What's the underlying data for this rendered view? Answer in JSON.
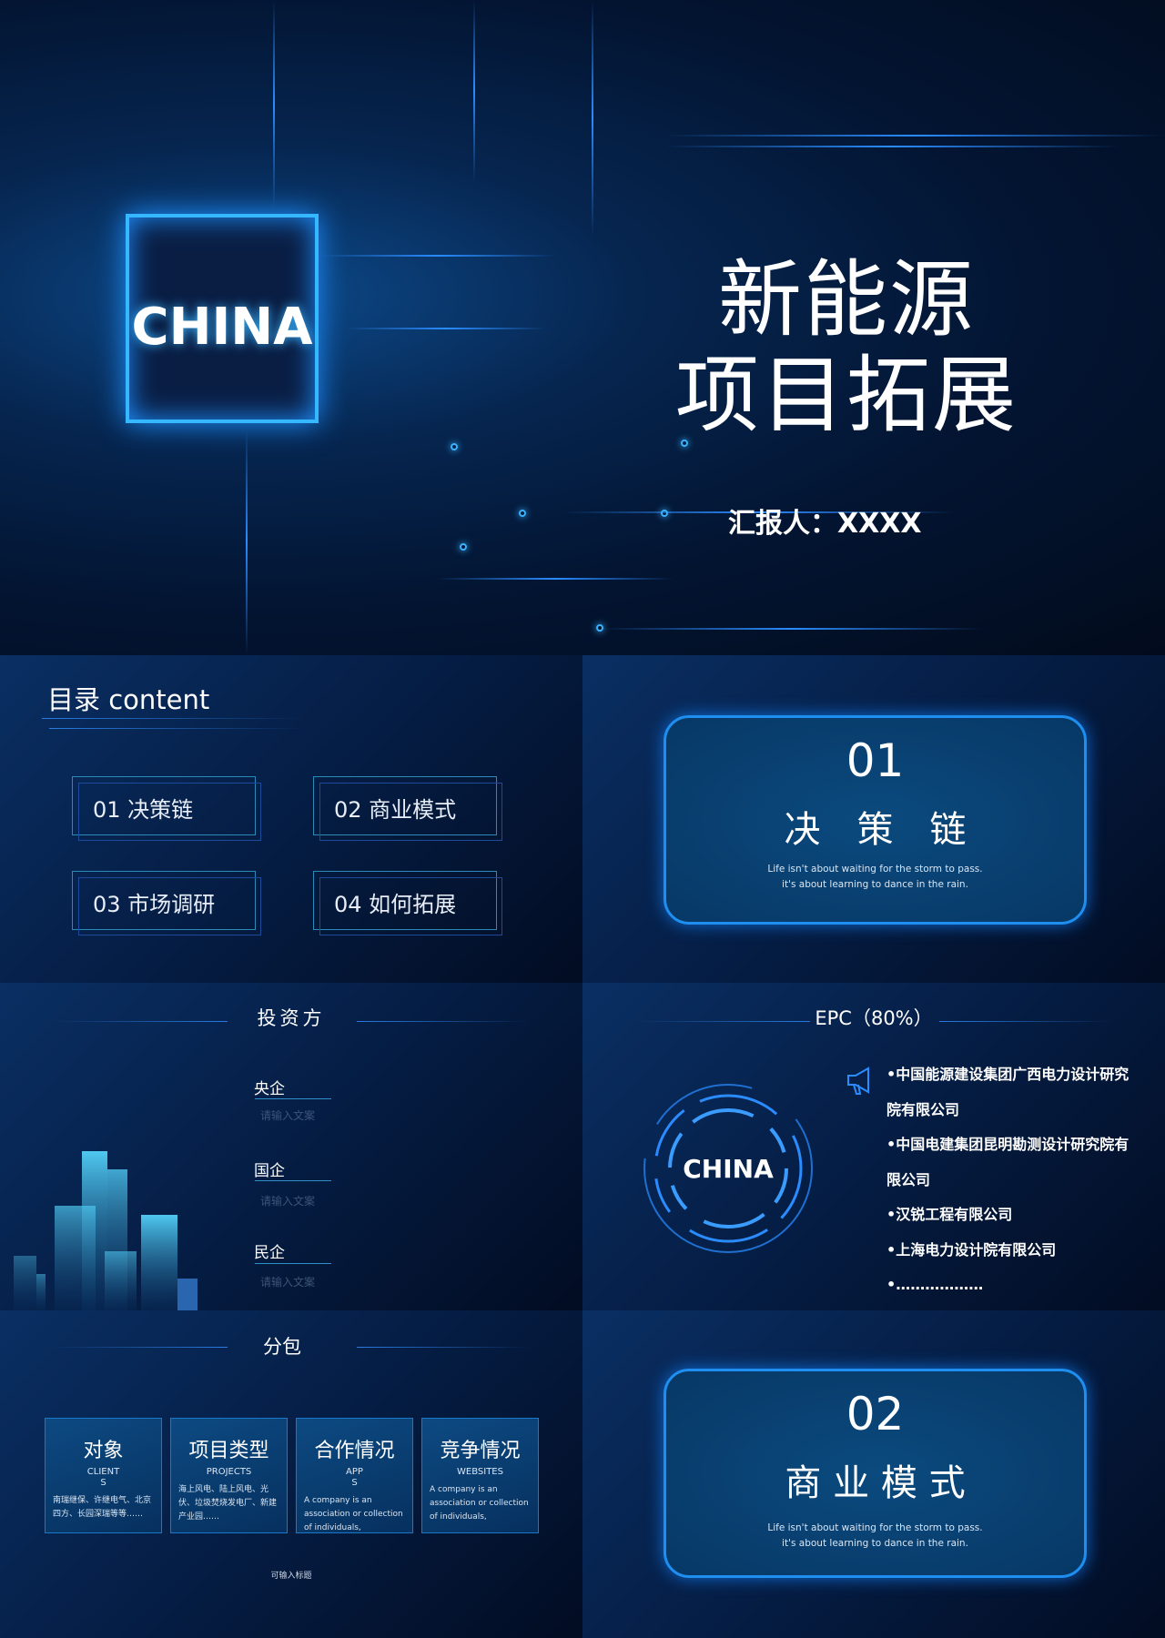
{
  "cover": {
    "chip_label": "CHINA",
    "title_line1": "新能源",
    "title_line2": "项目拓展",
    "reporter": "汇报人：XXXX"
  },
  "toc": {
    "title": "目录 content",
    "items": [
      "01  决策链",
      "02  商业模式",
      "03  市场调研",
      "04  如何拓展"
    ]
  },
  "section1": {
    "number": "01",
    "name": "决　策　链",
    "quote_line1": "Life isn't about waiting for the storm to pass.",
    "quote_line2": "it's about learning to dance in the rain."
  },
  "investors": {
    "title": "投资方",
    "items": [
      {
        "label": "央企",
        "placeholder": "请输入文案"
      },
      {
        "label": "国企",
        "placeholder": "请输入文案"
      },
      {
        "label": "民企",
        "placeholder": "请输入文案"
      }
    ]
  },
  "epc": {
    "title": "EPC（80%）",
    "circle_label": "CHINA",
    "icon": "megaphone-icon",
    "items": [
      "•中国能源建设集团广西电力设计研究院有限公司",
      "•中国电建集团昆明勘测设计研究院有限公司",
      "•汉锐工程有限公司",
      "•上海电力设计院有限公司",
      "•………………"
    ]
  },
  "subcontract": {
    "title": "分包",
    "cards": [
      {
        "title": "对象",
        "en": "CLIENT\nS",
        "desc": "南瑞继保、许继电气、北京四方、长园深瑞等等……"
      },
      {
        "title": "项目类型",
        "en": "PROJECTS",
        "desc": "海上风电、陆上风电、光伏、垃圾焚烧发电厂、新建产业园……"
      },
      {
        "title": "合作情况",
        "en": "APP\nS",
        "desc": "A company is an association or collection of individuals,"
      },
      {
        "title": "竞争情况",
        "en": "WEBSITES",
        "desc": "A company is an association or collection of individuals,"
      }
    ],
    "footer": "可输入标题"
  },
  "section2": {
    "number": "02",
    "name": "商 业 模 式",
    "quote_line1": "Life isn't about waiting for the storm to pass.",
    "quote_line2": "it's about learning to dance in the rain."
  },
  "colors": {
    "accent": "#2a8cff",
    "background": "#021433",
    "frame": "#1e8ff0"
  }
}
